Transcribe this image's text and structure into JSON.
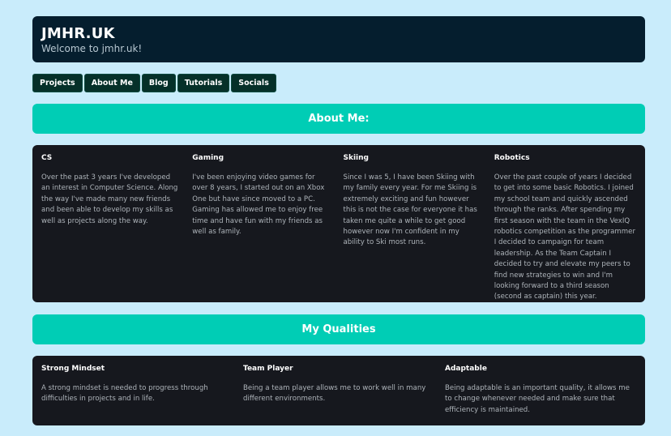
{
  "header": {
    "title": "JMHR.UK",
    "subtitle": "Welcome to jmhr.uk!"
  },
  "nav": {
    "items": [
      "Projects",
      "About Me",
      "Blog",
      "Tutorials",
      "Socials"
    ]
  },
  "about": {
    "heading": "About Me:",
    "columns": [
      {
        "title": "CS",
        "text": "Over the past 3 years I've developed an interest in Computer Science. Along the way I've made many new friends and been able to develop my skills as well as projects along the way."
      },
      {
        "title": "Gaming",
        "text": "I've been enjoying video games for over 8 years, I started out on an Xbox One but have since moved to a PC. Gaming has allowed me to enjoy free time and have fun with my friends as well as family."
      },
      {
        "title": "Skiing",
        "text": "Since I was 5, I have been Skiing with my family every year. For me Skiing is extremely exciting and fun however this is not the case for everyone it has taken me quite a while to get good however now I'm confident in my ability to Ski most runs."
      },
      {
        "title": "Robotics",
        "text": "Over the past couple of years I decided to get into some basic Robotics. I joined my school team and quickly ascended through the ranks. After spending my first season with the team in the VexIQ robotics competition as the programmer I decided to campaign for team leadership. As the Team Captain I decided to try and elevate my peers to find new strategies to win and I'm looking forward to a third season (second as captain) this year."
      }
    ]
  },
  "qualities": {
    "heading": "My Qualities",
    "columns": [
      {
        "title": "Strong Mindset",
        "text": "A strong mindset is needed to progress through difficulties in projects and in life."
      },
      {
        "title": "Team Player",
        "text": "Being a team player allows me to work well in many different environments."
      },
      {
        "title": "Adaptable",
        "text": "Being adaptable is an important quality, it allows me to change whenever needed and make sure that efficiency is maintained."
      }
    ]
  },
  "colors": {
    "page_background": "#c9ecfb",
    "header_background": "#051e2e",
    "nav_button": "#053029",
    "accent_banner": "#00cdb5",
    "panel_background": "#16181e"
  }
}
